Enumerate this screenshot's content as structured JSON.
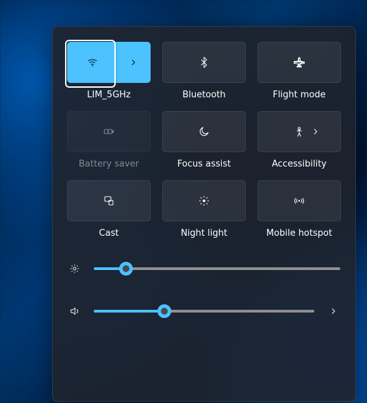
{
  "tiles": [
    {
      "id": "wifi",
      "label": "LIM_5GHz",
      "icon": "wifi",
      "active": true,
      "enabled": true,
      "expandable": true,
      "focused": true
    },
    {
      "id": "bluetooth",
      "label": "Bluetooth",
      "icon": "bluetooth",
      "active": false,
      "enabled": true,
      "expandable": false
    },
    {
      "id": "flight",
      "label": "Flight mode",
      "icon": "airplane",
      "active": false,
      "enabled": true,
      "expandable": false
    },
    {
      "id": "battery",
      "label": "Battery saver",
      "icon": "battery",
      "active": false,
      "enabled": false,
      "expandable": false
    },
    {
      "id": "focus",
      "label": "Focus assist",
      "icon": "moon",
      "active": false,
      "enabled": true,
      "expandable": false
    },
    {
      "id": "accessibility",
      "label": "Accessibility",
      "icon": "person",
      "active": false,
      "enabled": true,
      "expandable": true,
      "inline_chevron": true
    },
    {
      "id": "cast",
      "label": "Cast",
      "icon": "cast",
      "active": false,
      "enabled": true,
      "expandable": false
    },
    {
      "id": "nightlight",
      "label": "Night light",
      "icon": "sun",
      "active": false,
      "enabled": true,
      "expandable": false
    },
    {
      "id": "hotspot",
      "label": "Mobile hotspot",
      "icon": "hotspot",
      "active": false,
      "enabled": true,
      "expandable": false
    }
  ],
  "sliders": {
    "brightness": {
      "icon": "brightness",
      "value": 13,
      "expandable": false
    },
    "volume": {
      "icon": "volume",
      "value": 32,
      "expandable": true
    }
  },
  "colors": {
    "accent": "#4cc2ff"
  }
}
